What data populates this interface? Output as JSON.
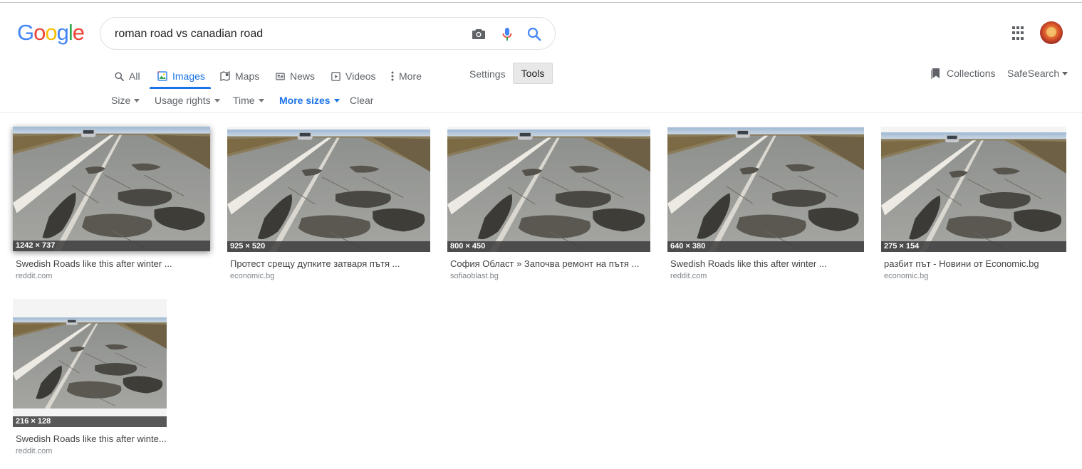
{
  "logo": [
    "G",
    "o",
    "o",
    "g",
    "l",
    "e"
  ],
  "search": {
    "query": "roman road vs canadian road"
  },
  "tabs": [
    {
      "label": "All",
      "icon": "search-icon"
    },
    {
      "label": "Images",
      "icon": "image-icon"
    },
    {
      "label": "Maps",
      "icon": "map-pin-icon"
    },
    {
      "label": "News",
      "icon": "news-icon"
    },
    {
      "label": "Videos",
      "icon": "play-icon"
    },
    {
      "label": "More",
      "icon": "kebab-icon"
    }
  ],
  "active_tab": "Images",
  "settings_label": "Settings",
  "tools_label": "Tools",
  "collections_label": "Collections",
  "safesearch_label": "SafeSearch",
  "tools_row": [
    {
      "label": "Size",
      "highlight": false
    },
    {
      "label": "Usage rights",
      "highlight": false
    },
    {
      "label": "Time",
      "highlight": false
    },
    {
      "label": "More sizes",
      "highlight": true
    },
    {
      "label": "Clear",
      "highlight": false
    }
  ],
  "results": [
    {
      "dims": "1242 × 737",
      "title": "Swedish Roads like this after winter ...",
      "site": "reddit.com"
    },
    {
      "dims": "925 × 520",
      "title": "Протест срещу дупките затваря пътя ...",
      "site": "economic.bg"
    },
    {
      "dims": "800 × 450",
      "title": "София Област » Започва ремонт на пътя ...",
      "site": "sofiaoblast.bg"
    },
    {
      "dims": "640 × 380",
      "title": "Swedish Roads like this after winter ...",
      "site": "reddit.com"
    },
    {
      "dims": "275 × 154",
      "title": "разбит път - Новини от Economic.bg",
      "site": "economic.bg"
    },
    {
      "dims": "216 × 128",
      "title": "Swedish Roads like this after winte...",
      "site": "reddit.com"
    }
  ],
  "colors": {
    "accent": "#1a73e8",
    "logo_blue": "#4285F4",
    "logo_red": "#EA4335",
    "logo_yellow": "#FBBC05",
    "logo_green": "#34A853"
  }
}
